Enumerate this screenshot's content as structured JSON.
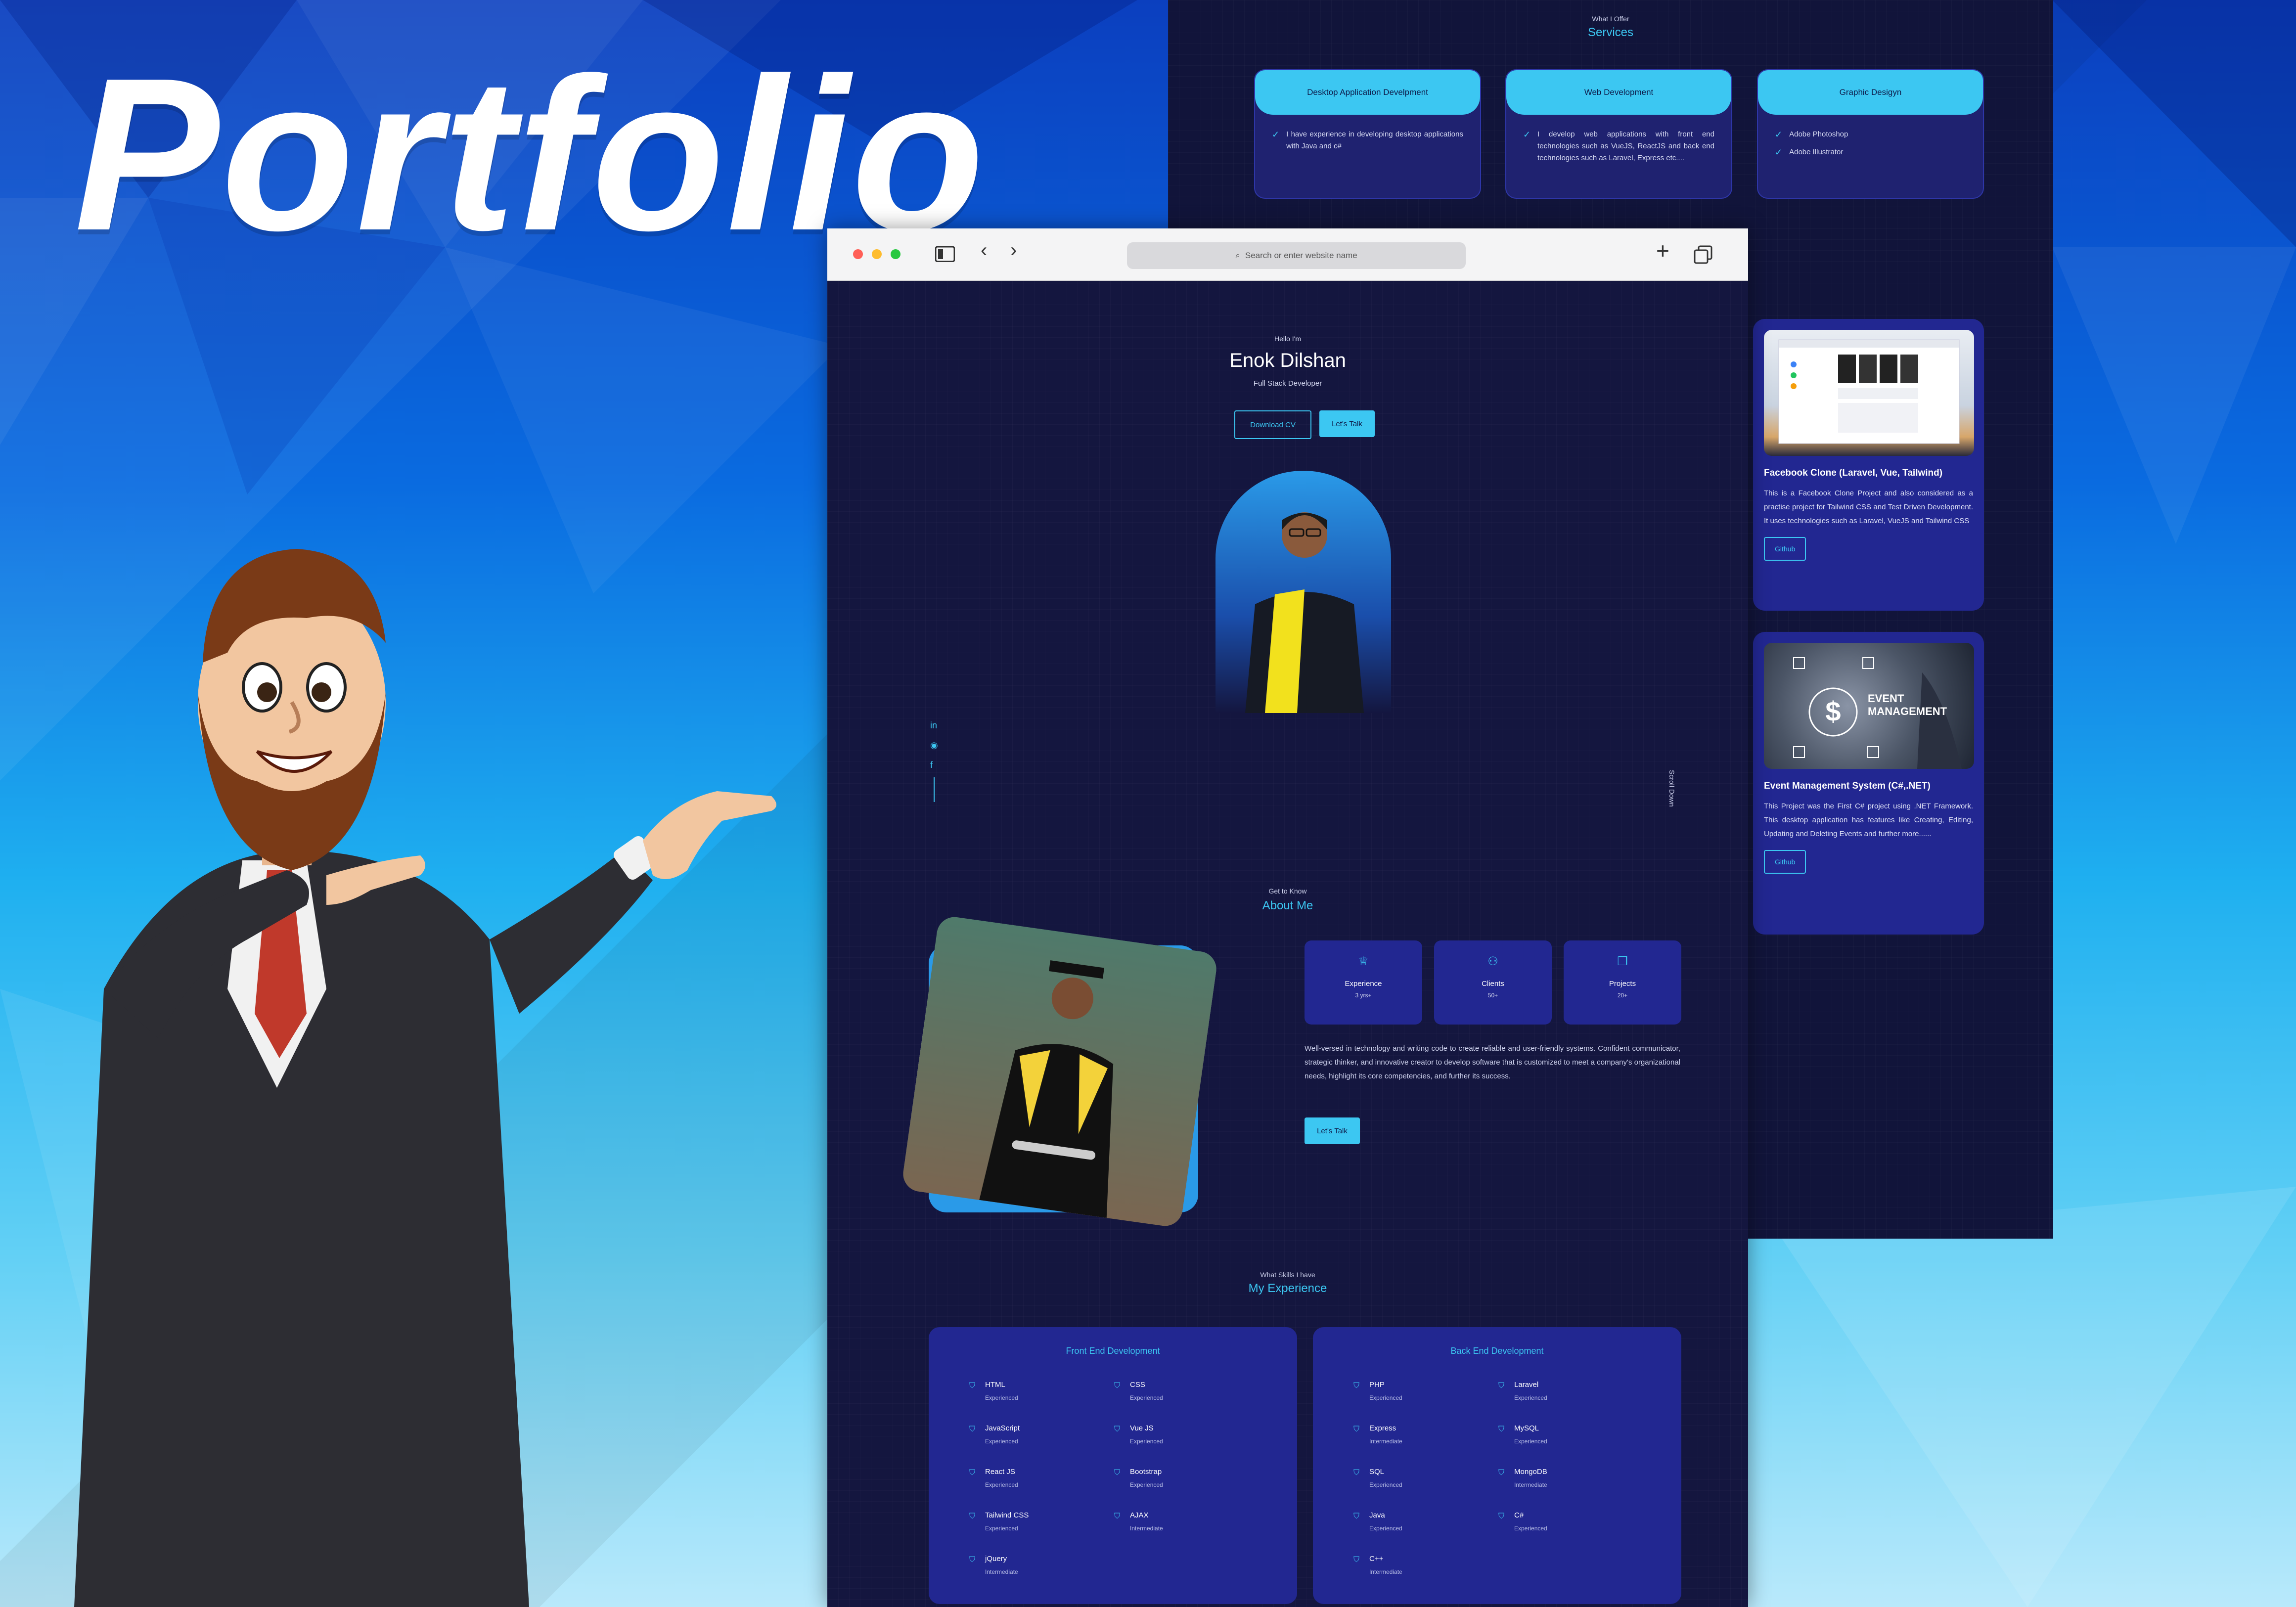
{
  "banner": {
    "title": "Portfolio"
  },
  "services": {
    "kicker": "What I Offer",
    "title": "Services",
    "cards": [
      {
        "title": "Desktop Application Develpment",
        "items": [
          "I have experience in developing desktop applications with Java and c#"
        ]
      },
      {
        "title": "Web Development",
        "items": [
          "I develop web applications with front end technologies such as VueJS, ReactJS and back end technologies such as Laravel, Express etc...."
        ]
      },
      {
        "title": "Graphic Desigyn",
        "items": [
          "Adobe Photoshop",
          "Adobe Illustrator"
        ]
      }
    ]
  },
  "projects": [
    {
      "title": "Facebook Clone (Laravel, Vue, Tailwind)",
      "desc": "This is a Facebook Clone Project and also considered as a practise project for Tailwind CSS and Test Driven Development. It uses technologies such as Laravel, VueJS and Tailwind CSS",
      "button": "Github"
    },
    {
      "title": "Event Management System (C#,.NET)",
      "desc": "This Project was the First C# project using .NET Framework. This desktop application has features like Creating, Editing, Updating and Deleting Events and further more......",
      "button": "Github",
      "thumb_text": "EVENT MANAGEMENT"
    }
  ],
  "browser": {
    "address_placeholder": "Search or enter website name"
  },
  "hero": {
    "hello": "Hello I'm",
    "name": "Enok Dilshan",
    "role": "Full Stack Developer",
    "download_cv": "Download CV",
    "lets_talk": "Let's Talk",
    "scroll_down": "Scroll Down"
  },
  "about": {
    "kicker": "Get to Know",
    "title": "About Me",
    "stats": [
      {
        "label": "Experience",
        "value": "3 yrs+"
      },
      {
        "label": "Clients",
        "value": "50+"
      },
      {
        "label": "Projects",
        "value": "20+"
      }
    ],
    "text": "Well-versed in technology and writing code to create reliable and user-friendly systems. Confident communicator, strategic thinker, and innovative creator to develop software that is customized to meet a company's organizational needs, highlight its core competencies, and further its success.",
    "button": "Let's Talk"
  },
  "experience": {
    "kicker": "What Skills I have",
    "title": "My Experience",
    "frontend": {
      "title": "Front End Development",
      "skills": [
        {
          "name": "HTML",
          "level": "Experienced"
        },
        {
          "name": "CSS",
          "level": "Experienced"
        },
        {
          "name": "JavaScript",
          "level": "Experienced"
        },
        {
          "name": "Vue JS",
          "level": "Experienced"
        },
        {
          "name": "React JS",
          "level": "Experienced"
        },
        {
          "name": "Bootstrap",
          "level": "Experienced"
        },
        {
          "name": "Tailwind CSS",
          "level": "Experienced"
        },
        {
          "name": "AJAX",
          "level": "Intermediate"
        },
        {
          "name": "jQuery",
          "level": "Intermediate"
        }
      ]
    },
    "backend": {
      "title": "Back End Development",
      "skills": [
        {
          "name": "PHP",
          "level": "Experienced"
        },
        {
          "name": "Laravel",
          "level": "Experienced"
        },
        {
          "name": "Express",
          "level": "Intermediate"
        },
        {
          "name": "MySQL",
          "level": "Experienced"
        },
        {
          "name": "SQL",
          "level": "Experienced"
        },
        {
          "name": "MongoDB",
          "level": "Intermediate"
        },
        {
          "name": "Java",
          "level": "Experienced"
        },
        {
          "name": "C#",
          "level": "Experienced"
        },
        {
          "name": "C++",
          "level": "Intermediate"
        }
      ]
    }
  },
  "colors": {
    "accent": "#3cc7f2",
    "panel": "#222791",
    "page_bg": "#14163f"
  }
}
